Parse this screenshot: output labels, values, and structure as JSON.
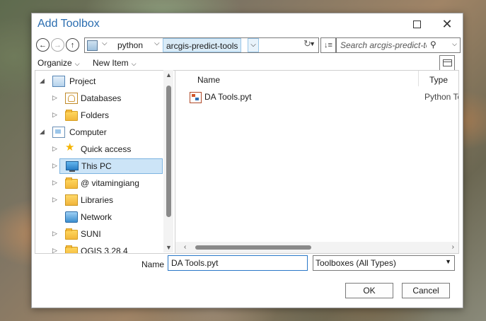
{
  "dialog": {
    "title": "Add Toolbox"
  },
  "window_controls": {
    "maximize": "□",
    "close": "✕"
  },
  "nav": {
    "back_icon": "arrow-left-icon",
    "forward_icon": "arrow-right-icon",
    "up_icon": "arrow-up-icon",
    "breadcrumbs": [
      "python",
      "arcgis-predict-tools"
    ],
    "search_placeholder": "Search arcgis-predict-tc"
  },
  "toolbar": {
    "organize_label": "Organize",
    "new_item_label": "New Item"
  },
  "tree": {
    "items": [
      {
        "label": "Project",
        "icon": "project-icon",
        "expanded": true
      },
      {
        "label": "Databases",
        "icon": "database-folder-icon"
      },
      {
        "label": "Folders",
        "icon": "folder-icon"
      },
      {
        "label": "Computer",
        "icon": "computer-icon",
        "expanded": true
      },
      {
        "label": "Quick access",
        "icon": "star-icon"
      },
      {
        "label": "This PC",
        "icon": "pc-monitor-icon",
        "selected": true
      },
      {
        "label": "@ vitamingiang",
        "icon": "folder-icon"
      },
      {
        "label": "Libraries",
        "icon": "library-icon"
      },
      {
        "label": "Network",
        "icon": "network-icon"
      },
      {
        "label": "SUNI",
        "icon": "folder-icon"
      },
      {
        "label": "QGIS 3.28.4",
        "icon": "folder-icon"
      }
    ]
  },
  "list": {
    "columns": [
      "Name",
      "Type"
    ],
    "rows": [
      {
        "name": "DA Tools.pyt",
        "type": "Python Toolbox",
        "icon": "python-toolbox-icon"
      }
    ]
  },
  "footer": {
    "name_label": "Name",
    "name_value": "DA Tools.pyt",
    "filter_value": "Toolboxes (All Types)",
    "ok_label": "OK",
    "cancel_label": "Cancel"
  }
}
